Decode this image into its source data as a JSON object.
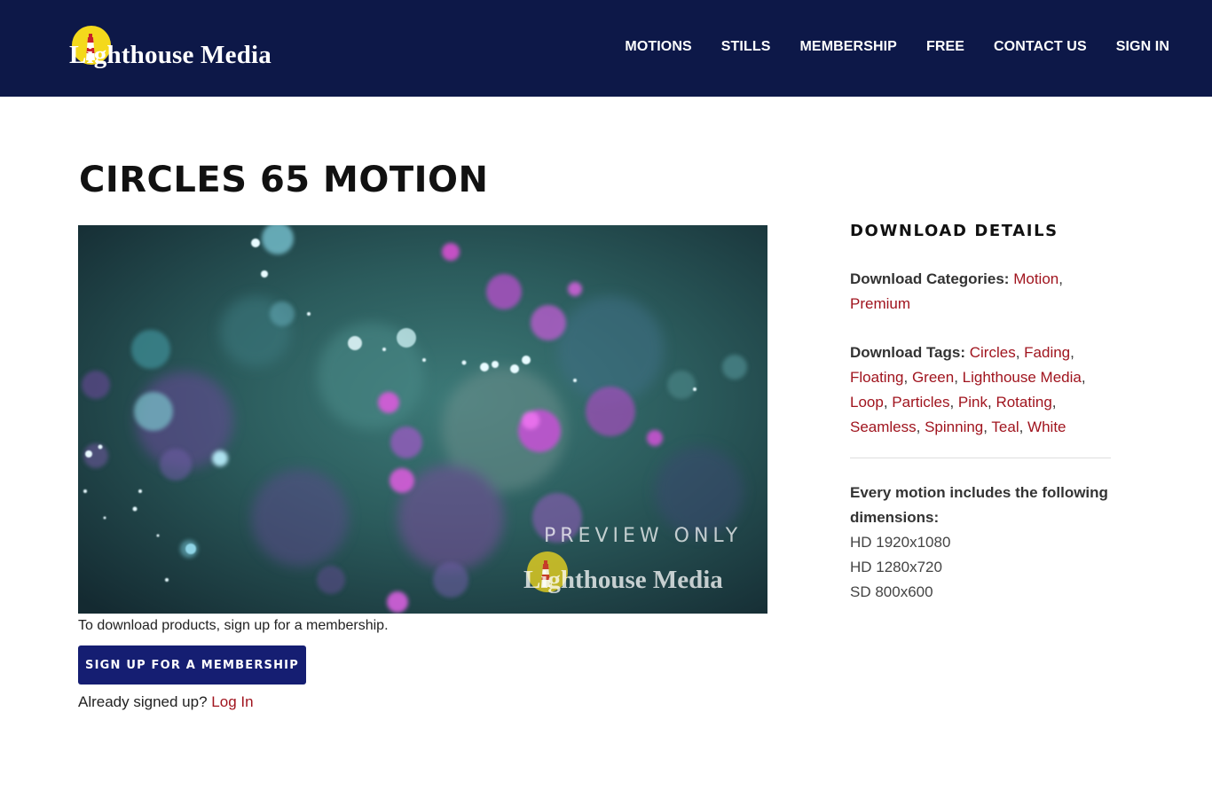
{
  "header": {
    "logo_text": "Lighthouse Media",
    "nav": [
      "MOTIONS",
      "STILLS",
      "MEMBERSHIP",
      "FREE",
      "CONTACT US",
      "SIGN IN"
    ]
  },
  "page": {
    "title": "CIRCLES 65 MOTION"
  },
  "preview": {
    "watermark_text": "PREVIEW ONLY",
    "watermark_logo_text": "Lighthouse Media"
  },
  "signup": {
    "note": "To download products, sign up for a membership.",
    "button_label": "SIGN UP FOR A MEMBERSHIP",
    "already_text": "Already signed up?",
    "login_link": "Log In"
  },
  "details": {
    "heading": "DOWNLOAD DETAILS",
    "categories_label": "Download Categories:",
    "categories": [
      "Motion",
      "Premium"
    ],
    "tags_label": "Download Tags:",
    "tags": [
      "Circles",
      "Fading",
      "Floating",
      "Green",
      "Lighthouse Media",
      "Loop",
      "Particles",
      "Pink",
      "Rotating",
      "Seamless",
      "Spinning",
      "Teal",
      "White"
    ],
    "dimensions_label": "Every motion includes the following dimensions:",
    "dimensions": [
      "HD 1920x1080",
      "HD 1280x720",
      "SD 800x600"
    ]
  },
  "colors": {
    "header_bg": "#0d1848",
    "button_bg": "#151e72",
    "link": "#a0141e",
    "logo_sun": "#f4d91c"
  }
}
